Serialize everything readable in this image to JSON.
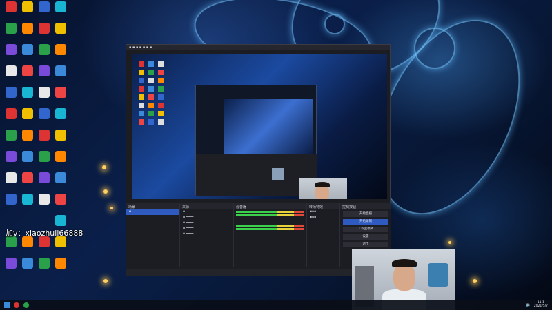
{
  "watermark": {
    "text": "加v：xiaozhuli66888"
  },
  "obs": {
    "docks": {
      "scenes_title": "场景",
      "sources_title": "来源",
      "mixer_title": "混音器",
      "transitions_title": "转场特效",
      "controls_title": "控制按钮"
    },
    "controls": [
      "开始直播",
      "开始录制",
      "工作室模式",
      "设置",
      "退出"
    ]
  },
  "taskbar": {
    "clock_time": "11:1",
    "clock_date": "2021/5/7"
  },
  "colors": {
    "accent": "#2f5bc1",
    "obs_bg": "#1c1d22"
  }
}
